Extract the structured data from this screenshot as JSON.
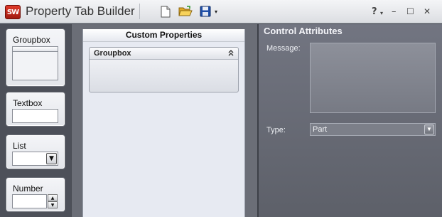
{
  "window": {
    "logo_text": "SW",
    "title": "Property Tab Builder",
    "toolbar": {
      "new_icon": "new-document-icon",
      "open_icon": "open-folder-icon",
      "save_icon": "save-disk-icon",
      "save_dropdown_glyph": "▾"
    },
    "controls": {
      "help_glyph": "?",
      "help_dropdown_glyph": "▾",
      "minimize_glyph": "–",
      "maximize_glyph": "☐",
      "close_glyph": "✕"
    }
  },
  "toolbox": {
    "items": [
      {
        "label": "Groupbox"
      },
      {
        "label": "Textbox"
      },
      {
        "label": "List"
      },
      {
        "label": "Number"
      }
    ],
    "combo_arrow": "▼",
    "spin_up": "▲",
    "spin_down": "▼"
  },
  "custom_properties": {
    "title": "Custom Properties",
    "groupbox": {
      "label": "Groupbox",
      "collapse_glyph": "⌃"
    }
  },
  "control_attributes": {
    "title": "Control Attributes",
    "message_label": "Message:",
    "message_value": "",
    "type_label": "Type:",
    "type_value": "Part",
    "type_arrow": "▼"
  },
  "colors": {
    "accent_red": "#c8281a",
    "save_blue": "#1f4fa8",
    "folder_yellow": "#f2c230",
    "panel_dark": "#5d6069"
  }
}
